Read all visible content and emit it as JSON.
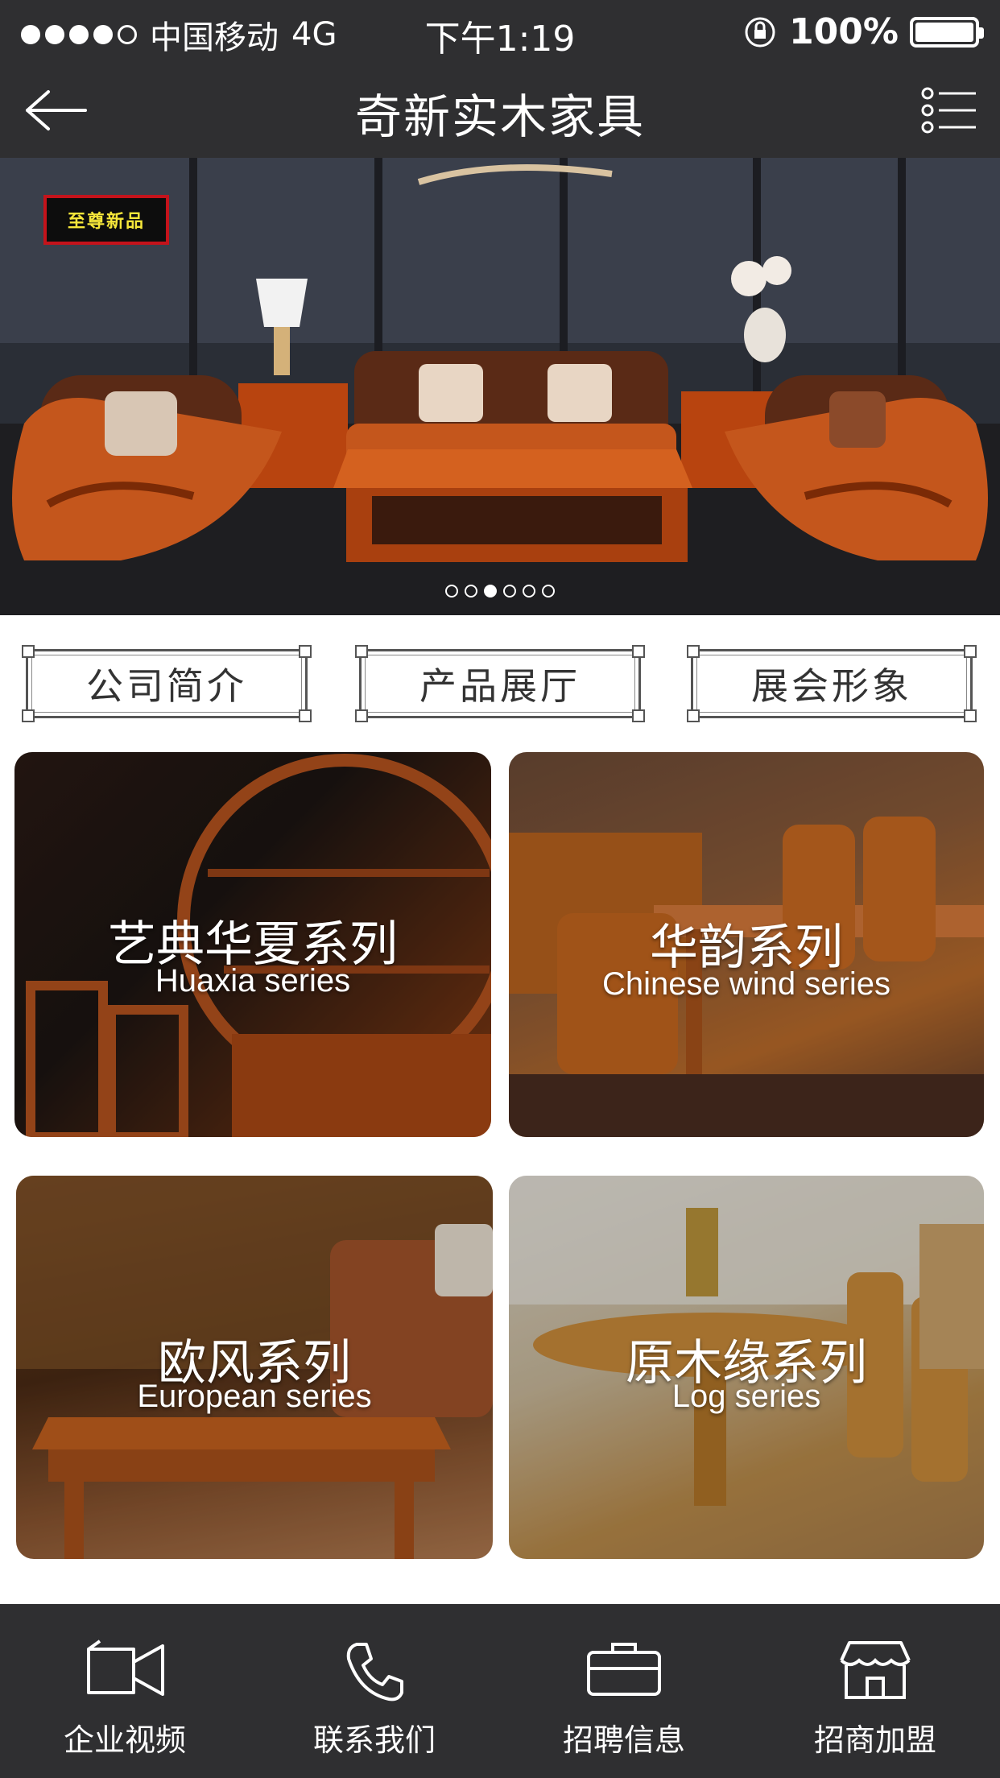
{
  "status_bar": {
    "carrier": "中国移动",
    "network": "4G",
    "time": "下午1:19",
    "battery": "100%"
  },
  "header": {
    "title": "奇新实木家具",
    "back_icon": "arrow-left-icon",
    "menu_icon": "list-menu-icon"
  },
  "banner": {
    "badge": "至尊新品",
    "slide_count": 6,
    "active_slide": 3
  },
  "quick_links": [
    {
      "label": "公司简介"
    },
    {
      "label": "产品展厅"
    },
    {
      "label": "展会形象"
    }
  ],
  "series": [
    {
      "zh": "艺典华夏系列",
      "en": "Huaxia series"
    },
    {
      "zh": "华韵系列",
      "en": "Chinese wind series"
    },
    {
      "zh": "欧风系列",
      "en": "European series"
    },
    {
      "zh": "原木缘系列",
      "en": "Log series"
    }
  ],
  "bottom_nav": [
    {
      "label": "企业视频",
      "icon": "video-camera-icon"
    },
    {
      "label": "联系我们",
      "icon": "phone-icon"
    },
    {
      "label": "招聘信息",
      "icon": "briefcase-icon"
    },
    {
      "label": "招商加盟",
      "icon": "storefront-icon"
    }
  ],
  "colors": {
    "bar_bg": "#2f2f31",
    "wood_accent": "#c4561c",
    "badge_border": "#c4131b",
    "badge_text": "#f5e63a"
  }
}
